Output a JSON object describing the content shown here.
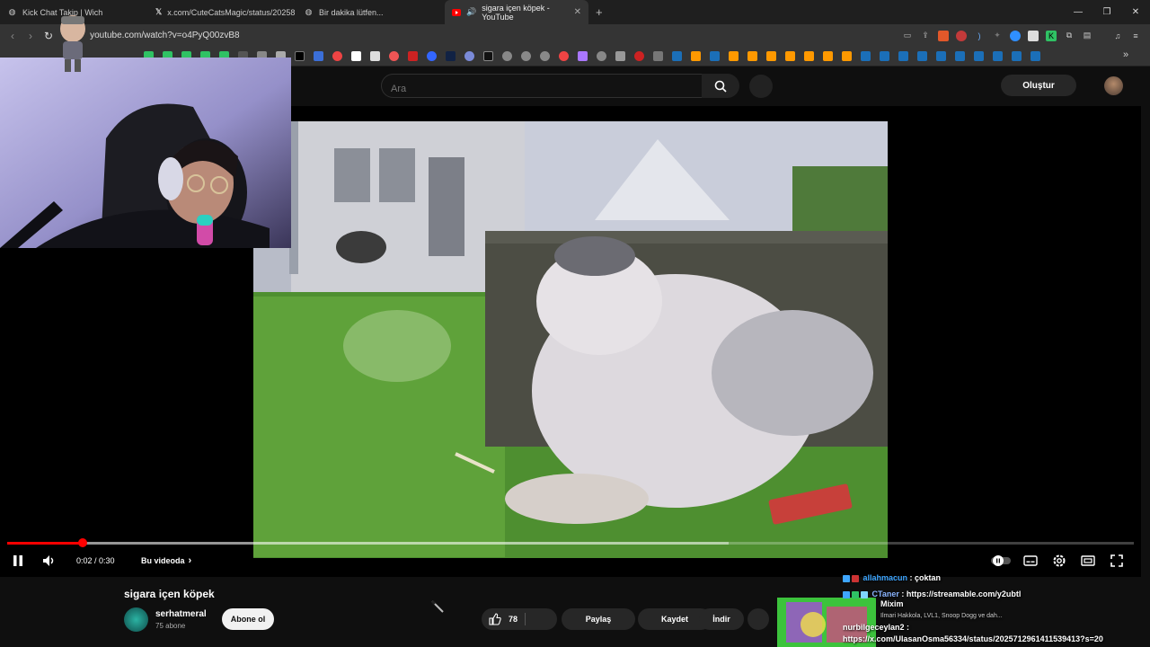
{
  "browser": {
    "tabs": [
      {
        "title": "Kick Chat Takip | Wich",
        "icon": "globe-icon"
      },
      {
        "title": "x.com/CuteCatsMagic/status/20258",
        "icon": "x-logo-icon"
      },
      {
        "title": "Bir dakika lütfen...",
        "icon": "globe-icon"
      },
      {
        "title": "sigara içen köpek - YouTube",
        "icon": "youtube-icon"
      }
    ],
    "url": "youtube.com/watch?v=o4PyQ00zvB8"
  },
  "youtube": {
    "search_placeholder": "Ara",
    "create_label": "Oluştur"
  },
  "player": {
    "time": "0:02 / 0:30",
    "chapter": "Bu videoda",
    "progress_fraction": 0.0667,
    "buffer_fraction": 0.64,
    "accent_color": "#ff0000"
  },
  "video": {
    "title": "sigara içen köpek",
    "channel": "serhatmeral",
    "subscribers": "75 abone",
    "subscribe_label": "Abone ol",
    "likes": "78",
    "share_label": "Paylaş",
    "save_label": "Kaydet",
    "download_label": "İndir"
  },
  "chat": {
    "lines": [
      {
        "user": "allahmacun",
        "text": "çoktan",
        "color": "#3ea6ff"
      },
      {
        "user": "CTaner",
        "text": "https://streamable.com/y2ubtl",
        "color": "#8ab4ff"
      },
      {
        "user": "Mixim",
        "text": "",
        "color": "#ffffff"
      },
      {
        "user": "",
        "text": "Ilmari Hakkola, LVL1, Snoop Dogg ve dah...",
        "color": "#cccccc"
      },
      {
        "user": "nurbilgeceylan2",
        "text": "",
        "color": "#ffffff"
      },
      {
        "user": "",
        "text": "https://x.com/UlasanOsma56334/status/2025712961411539413?s=20",
        "color": "#ffffff"
      }
    ]
  }
}
